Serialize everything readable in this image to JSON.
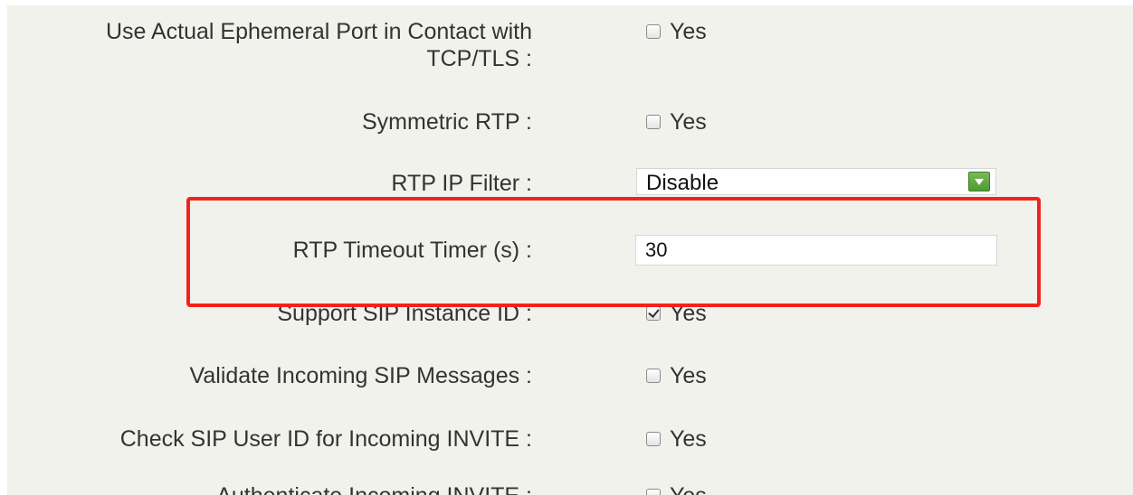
{
  "settings": {
    "rows": [
      {
        "label": "Use Actual Ephemeral Port in Contact with TCP/TLS :",
        "type": "checkbox",
        "checked": false,
        "option": "Yes"
      },
      {
        "label": "Symmetric RTP :",
        "type": "checkbox",
        "checked": false,
        "option": "Yes"
      },
      {
        "label": "RTP IP Filter :",
        "type": "select",
        "value": "Disable"
      },
      {
        "label": "RTP Timeout Timer (s) :",
        "type": "text",
        "value": "30"
      },
      {
        "label": "Support SIP Instance ID :",
        "type": "checkbox",
        "checked": true,
        "option": "Yes"
      },
      {
        "label": "Validate Incoming SIP Messages :",
        "type": "checkbox",
        "checked": false,
        "option": "Yes"
      },
      {
        "label": "Check SIP User ID for Incoming INVITE :",
        "type": "checkbox",
        "checked": false,
        "option": "Yes"
      },
      {
        "label": "Authenticate Incoming INVITE :",
        "type": "checkbox",
        "checked": false,
        "option": "Yes"
      }
    ]
  },
  "annotation": {
    "color": "#f0241d"
  },
  "colors": {
    "panel_background": "#f2f2ec",
    "dropdown_arrow": "#5ea83f"
  },
  "icons": {
    "dropdown": "triangle-down-icon"
  }
}
